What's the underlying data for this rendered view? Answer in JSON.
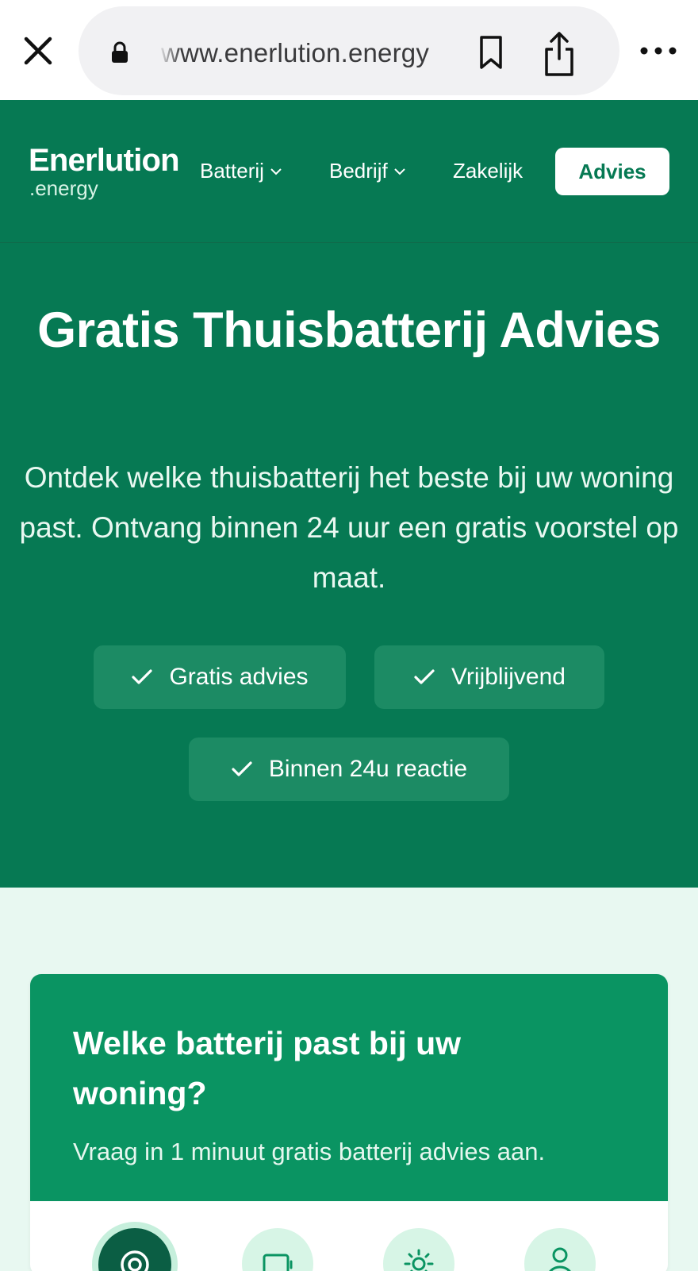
{
  "browser": {
    "url": "www.enerlution.energy"
  },
  "header": {
    "logo_title": "Enerlution",
    "logo_sub": ".energy",
    "nav": [
      {
        "label": "Batterij",
        "has_dropdown": true
      },
      {
        "label": "Bedrijf",
        "has_dropdown": true
      },
      {
        "label": "Zakelijk",
        "has_dropdown": false
      }
    ],
    "cta_label": "Advies"
  },
  "hero": {
    "title": "Gratis Thuisbatterij Advies",
    "subtitle": "Ontdek welke thuisbatterij het beste bij uw woning past. Ontvang binnen 24 uur een gratis voorstel op maat.",
    "badges": [
      "Gratis advies",
      "Vrijblijvend",
      "Binnen 24u reactie"
    ]
  },
  "card": {
    "title": "Welke batterij past bij uw woning?",
    "subtitle": "Vraag in 1 minuut gratis batterij advies aan.",
    "steps": [
      {
        "icon": "target-icon",
        "active": true
      },
      {
        "icon": "battery-icon",
        "active": false
      },
      {
        "icon": "sun-icon",
        "active": false
      },
      {
        "icon": "user-icon",
        "active": false
      }
    ]
  },
  "colors": {
    "brand_green": "#067953",
    "card_green": "#0a9462",
    "page_bg": "#e8f8f1"
  }
}
